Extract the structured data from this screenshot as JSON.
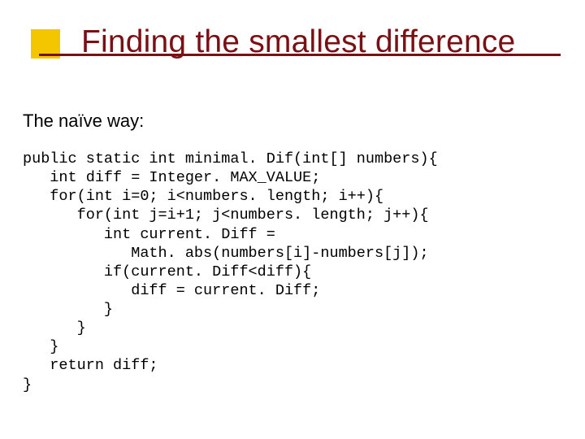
{
  "title": "Finding the smallest difference",
  "lead": "The naïve way:",
  "code_lines": [
    "public static int minimal. Dif(int[] numbers){",
    "   int diff = Integer. MAX_VALUE;",
    "   for(int i=0; i<numbers. length; i++){",
    "      for(int j=i+1; j<numbers. length; j++){",
    "         int current. Diff =",
    "            Math. abs(numbers[i]-numbers[j]);",
    "         if(current. Diff<diff){",
    "            diff = current. Diff;",
    "         }",
    "      }",
    "   }",
    "   return diff;",
    "}"
  ]
}
